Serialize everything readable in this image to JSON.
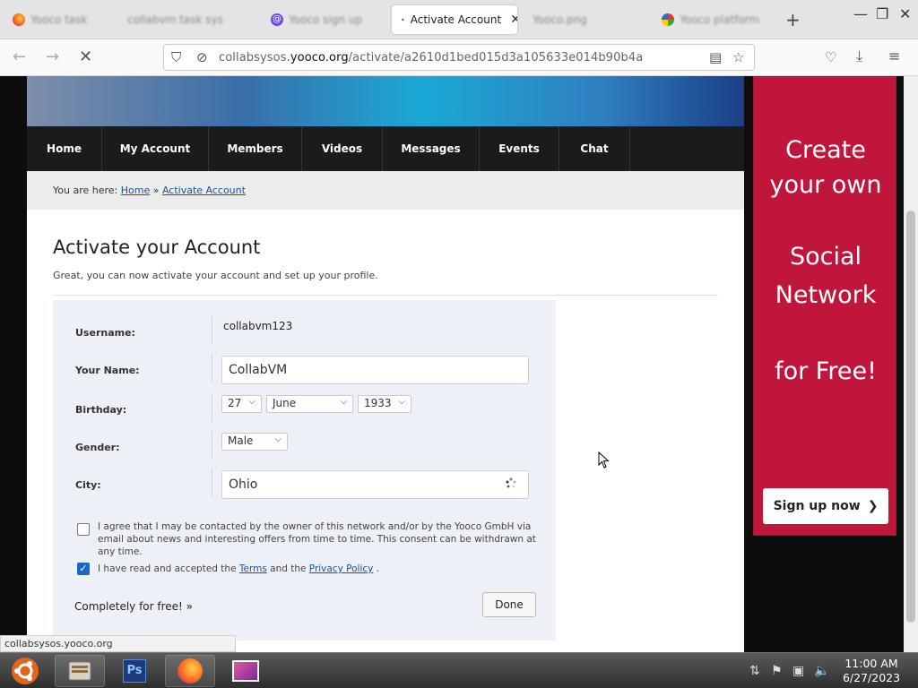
{
  "browser": {
    "tabs": [
      {
        "label": "Yooco task",
        "active": false
      },
      {
        "label": "collabvm task sys",
        "active": false
      },
      {
        "label": "Yooco sign up",
        "active": false
      },
      {
        "label": "Activate Account",
        "active": true
      },
      {
        "label": "Yooco.png",
        "active": false
      },
      {
        "label": "Yooco platform",
        "active": false
      }
    ],
    "url_prefix": "collabsysos.",
    "url_domain": "yooco.org",
    "url_path": "/activate/a2610d1bed015d3a105633e014b90b4a"
  },
  "nav": {
    "items": [
      "Home",
      "My Account",
      "Members",
      "Videos",
      "Messages",
      "Events",
      "Chat"
    ]
  },
  "breadcrumb": {
    "prefix": "You are here: ",
    "home": "Home",
    "sep": " » ",
    "current": "Activate Account"
  },
  "page": {
    "title": "Activate your Account",
    "subtitle": "Great, you can now activate your account and set up your profile."
  },
  "form": {
    "username_label": "Username:",
    "username_value": "collabvm123",
    "name_label": "Your Name:",
    "name_value": "CollabVM",
    "birthday_label": "Birthday:",
    "birthday_day": "27",
    "birthday_month": "June",
    "birthday_year": "1933",
    "gender_label": "Gender:",
    "gender_value": "Male",
    "city_label": "City:",
    "city_value": "Ohio",
    "consent_text": "I agree that I may be contacted by the owner of this network and/or by the Yooco GmbH via email about news and interesting offers from time to time. This consent can be withdrawn at any time.",
    "consent_checked": false,
    "terms_prefix": "I have read and accepted the ",
    "terms_link": "Terms",
    "terms_mid": " and the ",
    "privacy_link": "Privacy Policy",
    "terms_suffix": " .",
    "terms_checked": true,
    "free_link": "Completely for free! »",
    "done_label": "Done"
  },
  "ad": {
    "line1": "Create",
    "line2": "your own",
    "line3": "Social",
    "line4": "Network",
    "line5": "for Free!",
    "button": "Sign up now"
  },
  "status_bar": "collabsysos.yooco.org",
  "clock": {
    "time": "11:00 AM",
    "date": "6/27/2023"
  },
  "colors": {
    "ad_red": "#c0163b",
    "nav_dark": "#1b1b1b",
    "form_bg": "#eef0f7",
    "link": "#1d4f9a",
    "checkbox": "#1f66c4"
  },
  "icons": [
    "firefox-icon",
    "reload-icon",
    "back-icon",
    "forward-icon",
    "shield-icon",
    "lock-icon",
    "reader-icon",
    "star-icon",
    "pocket-icon",
    "download-icon",
    "menu-icon",
    "ubuntu-icon",
    "photoshop-icon",
    "mouse-cursor-icon"
  ]
}
